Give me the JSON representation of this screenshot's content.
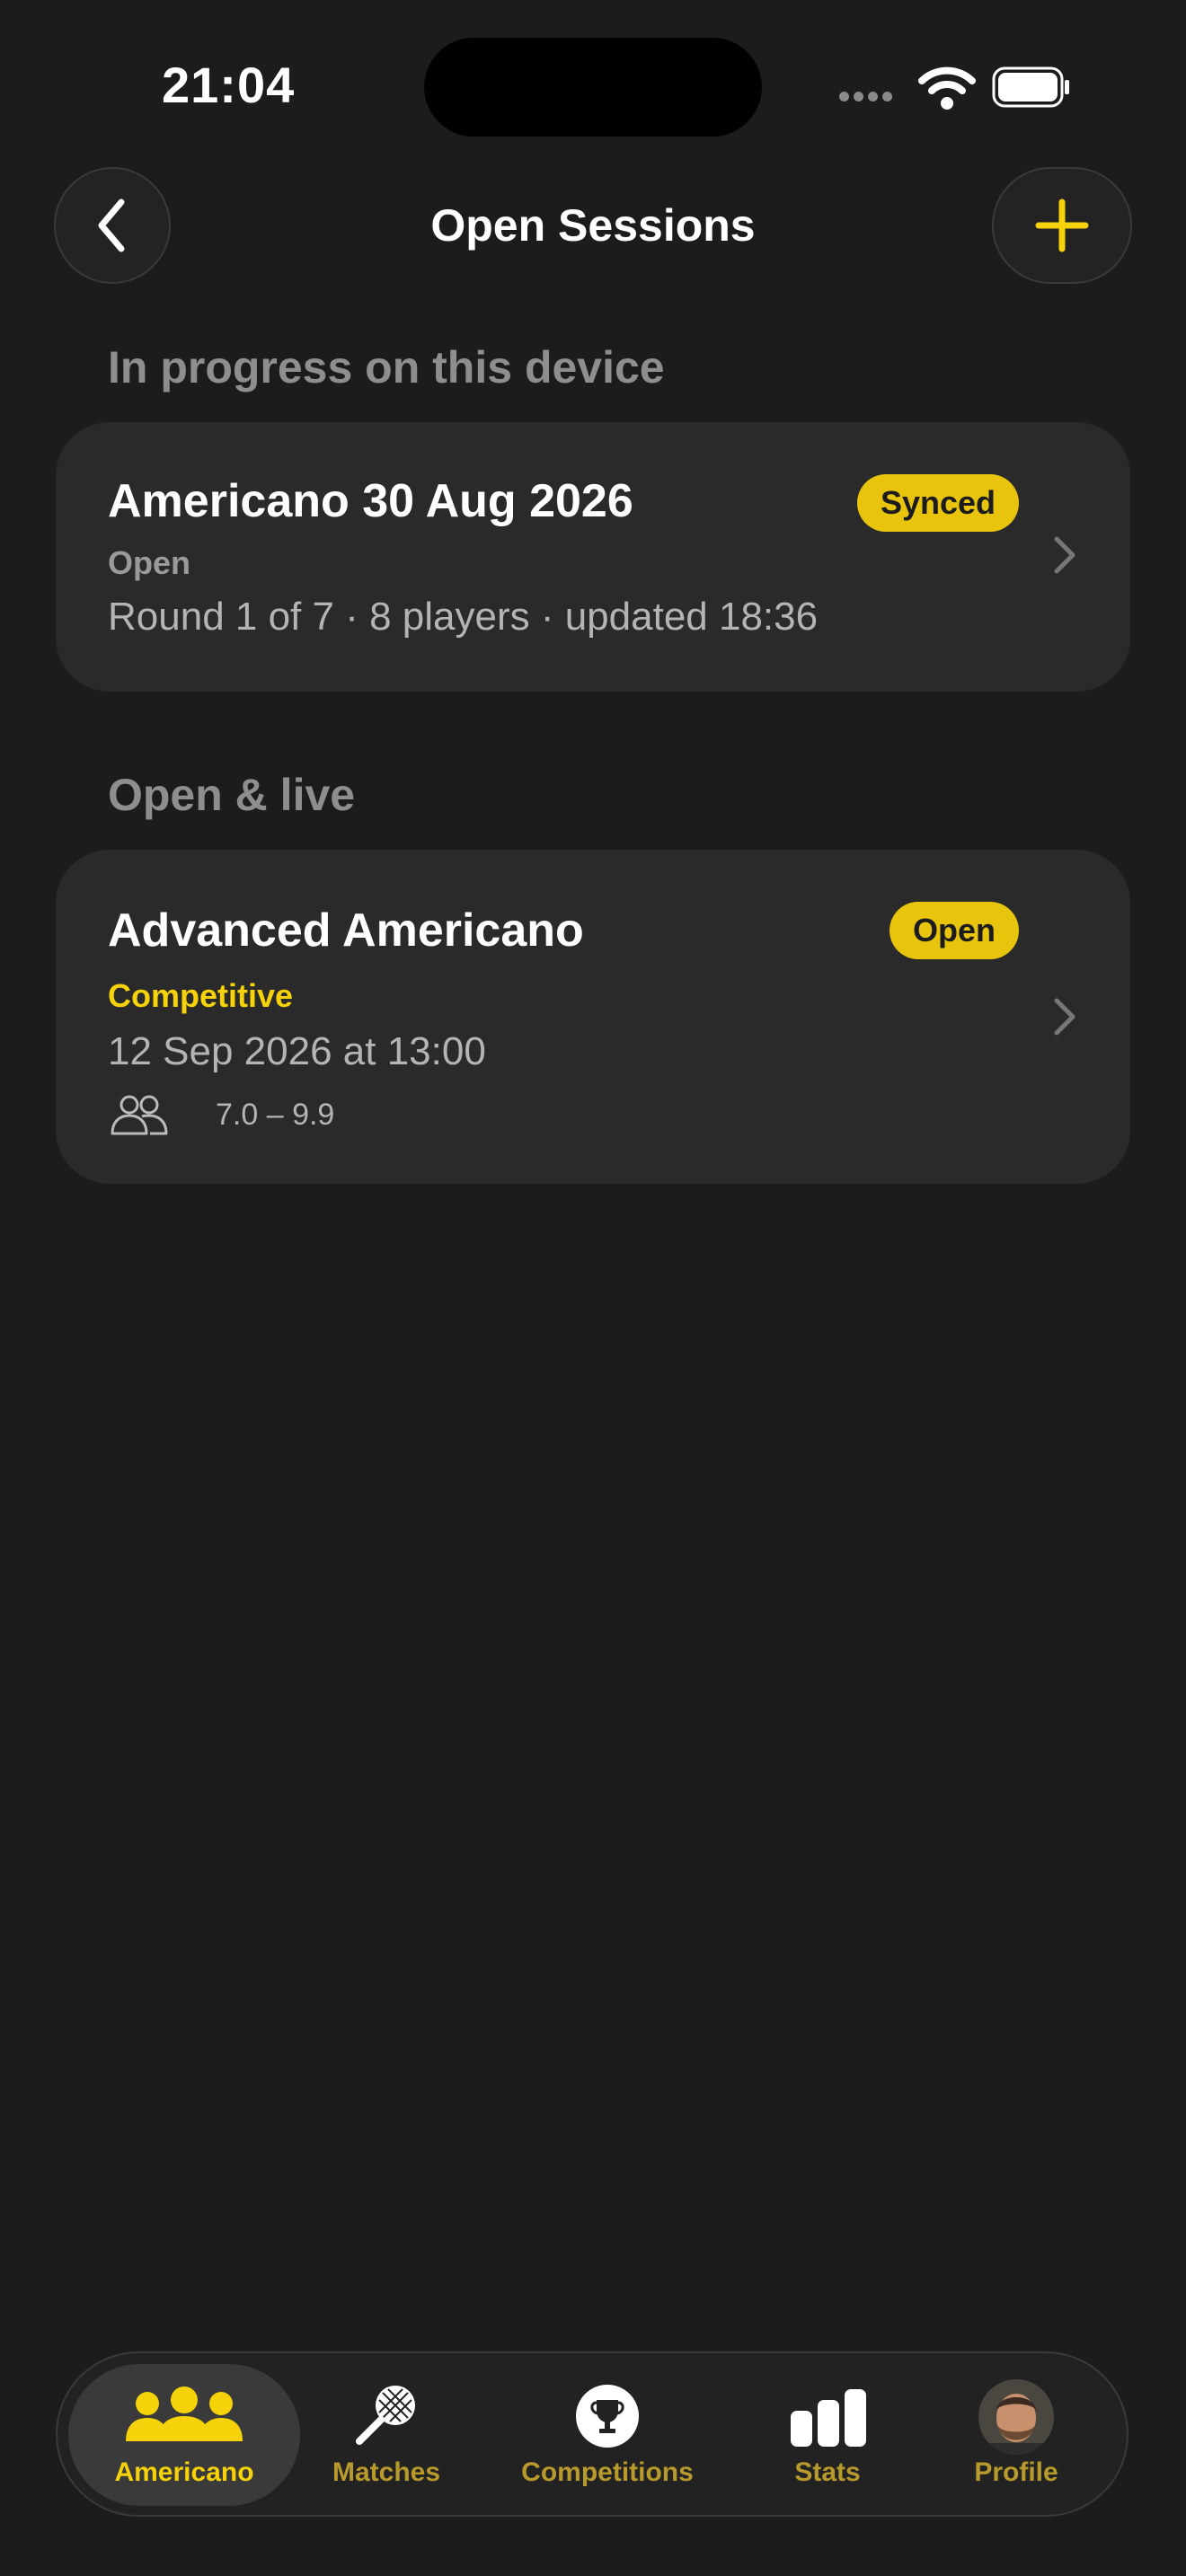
{
  "status_bar": {
    "time": "21:04"
  },
  "header": {
    "title": "Open Sessions",
    "back_icon": "chevron-left-icon",
    "add_icon": "plus-icon"
  },
  "sections": [
    {
      "label": "In progress on this device",
      "card": {
        "title": "Americano 30 Aug 2026",
        "badge": "Synced",
        "status": "Open",
        "details": "Round 1 of 7 · 8 players · updated 18:36"
      }
    },
    {
      "label": "Open & live",
      "card": {
        "title": "Advanced Americano",
        "badge": "Open",
        "category": "Competitive",
        "datetime": "12 Sep 2026 at 13:00",
        "level_range": "7.0 – 9.9",
        "level_icon": "people-icon"
      }
    }
  ],
  "tabbar": {
    "tabs": [
      {
        "label": "Americano",
        "icon": "group-icon",
        "active": true
      },
      {
        "label": "Matches",
        "icon": "racket-icon",
        "active": false
      },
      {
        "label": "Competitions",
        "icon": "trophy-icon",
        "active": false
      },
      {
        "label": "Stats",
        "icon": "bar-chart-icon",
        "active": false
      },
      {
        "label": "Profile",
        "icon": "avatar",
        "active": false
      }
    ]
  },
  "colors": {
    "accent": "#f5d20a",
    "badge": "#e8c40c",
    "background": "#1c1c1c",
    "card": "#2a2a2a",
    "muted": "#8e8e8e"
  }
}
